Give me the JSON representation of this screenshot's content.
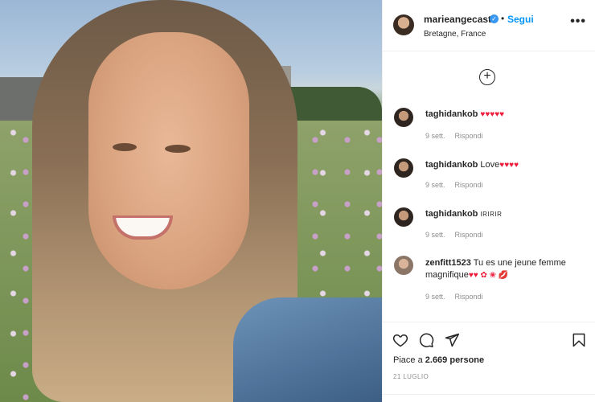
{
  "post_image": {
    "alt_icon": "photo"
  },
  "header": {
    "username": "marieangecasta",
    "verified_glyph": "✓",
    "separator": "•",
    "follow_label": "Segui",
    "location": "Bretagne, France",
    "more_glyph": "•••"
  },
  "load_more_glyph": "+",
  "comments": [
    {
      "user": "taghidankob",
      "text": "",
      "hearts": "♥♥♥♥♥",
      "time": "9 sett.",
      "reply": "Rispondi"
    },
    {
      "user": "taghidankob",
      "text": "Love",
      "hearts": "♥♥♥♥",
      "time": "9 sett.",
      "reply": "Rispondi"
    },
    {
      "user": "taghidankob",
      "text": "IRIRIR",
      "hearts": "",
      "time": "9 sett.",
      "reply": "Rispondi"
    },
    {
      "user": "zenfitt1523",
      "text": "Tu es une jeune femme magnifique",
      "hearts": "♥♥ ✿ ❀ 💋",
      "time": "9 sett.",
      "reply": "Rispondi"
    }
  ],
  "likes": {
    "prefix": "Piace a",
    "count": "2.669 persone"
  },
  "date": "21 LUGLIO",
  "colors": {
    "link": "#0095f6",
    "heart": "#ed1c3a",
    "muted": "#8e8e8e",
    "text": "#262626"
  }
}
